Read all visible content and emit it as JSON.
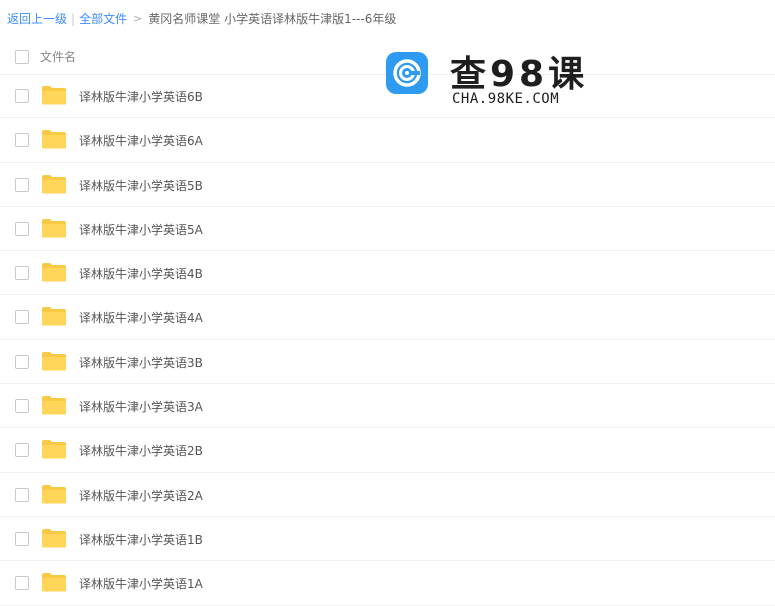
{
  "breadcrumb": {
    "back": "返回上一级",
    "all_files": "全部文件",
    "current": "黄冈名师课堂 小学英语译林版牛津版1---6年级"
  },
  "table": {
    "column_name": "文件名"
  },
  "files": [
    {
      "name": "译林版牛津小学英语6B"
    },
    {
      "name": "译林版牛津小学英语6A"
    },
    {
      "name": "译林版牛津小学英语5B"
    },
    {
      "name": "译林版牛津小学英语5A"
    },
    {
      "name": "译林版牛津小学英语4B"
    },
    {
      "name": "译林版牛津小学英语4A"
    },
    {
      "name": "译林版牛津小学英语3B"
    },
    {
      "name": "译林版牛津小学英语3A"
    },
    {
      "name": "译林版牛津小学英语2B"
    },
    {
      "name": "译林版牛津小学英语2A"
    },
    {
      "name": "译林版牛津小学英语1B"
    },
    {
      "name": "译林版牛津小学英语1A"
    }
  ],
  "watermark": {
    "title": "查98课",
    "url": "CHA.98KE.COM"
  },
  "colors": {
    "link": "#3b8cff",
    "folder": "#ffd659",
    "watermark_logo": "#2f9bf0"
  },
  "icons": {
    "folder": "folder-icon",
    "logo": "watermark-logo-icon"
  }
}
